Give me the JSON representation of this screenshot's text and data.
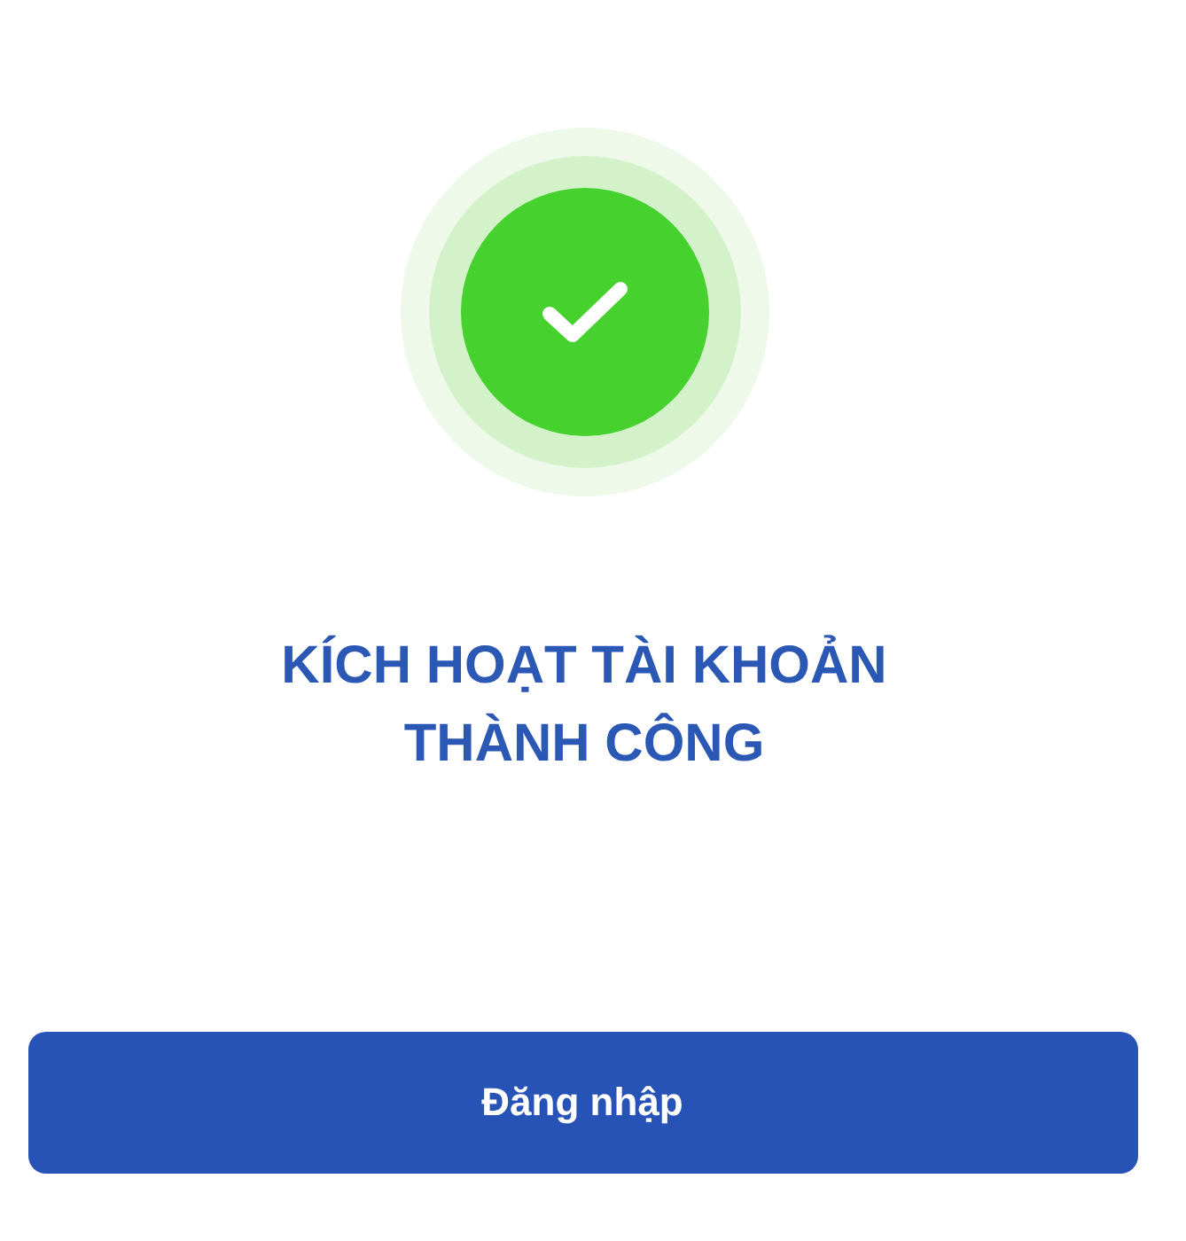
{
  "status": {
    "kind": "success"
  },
  "title": "KÍCH HOẠT TÀI KHOẢN\nTHÀNH CÔNG",
  "button": {
    "label": "Đăng nhập"
  }
}
